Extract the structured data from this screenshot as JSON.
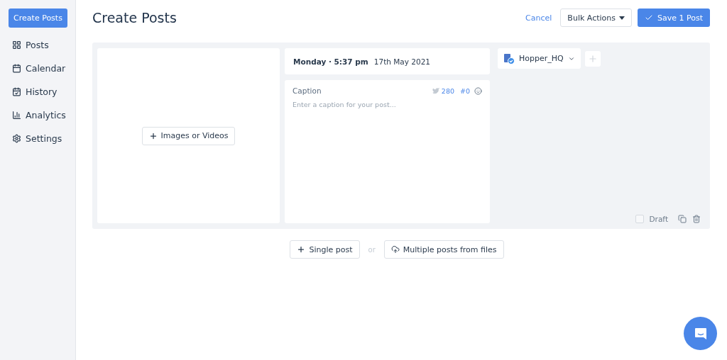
{
  "sidebar": {
    "create_button": "Create Posts",
    "items": [
      {
        "label": "Posts",
        "selected": false
      },
      {
        "label": "Calendar",
        "selected": false
      },
      {
        "label": "History",
        "selected": false
      },
      {
        "label": "Analytics",
        "selected": false
      },
      {
        "label": "Settings",
        "selected": false
      }
    ]
  },
  "header": {
    "title": "Create Posts",
    "cancel": "Cancel",
    "bulk_actions": "Bulk Actions",
    "save": "Save 1 Post"
  },
  "post": {
    "media_button": "Images or Videos",
    "day_time": "Monday · 5:37 pm",
    "date": "17th May 2021",
    "caption_label": "Caption",
    "char_count": "280",
    "hashtag_count": "#0",
    "caption_placeholder": "Enter a caption for your post...",
    "account": "Hopper_HQ",
    "draft_label": "Draft",
    "draft": false
  },
  "footer": {
    "single_post": "Single post",
    "or": "or",
    "multiple_posts": "Multiple posts from files"
  }
}
